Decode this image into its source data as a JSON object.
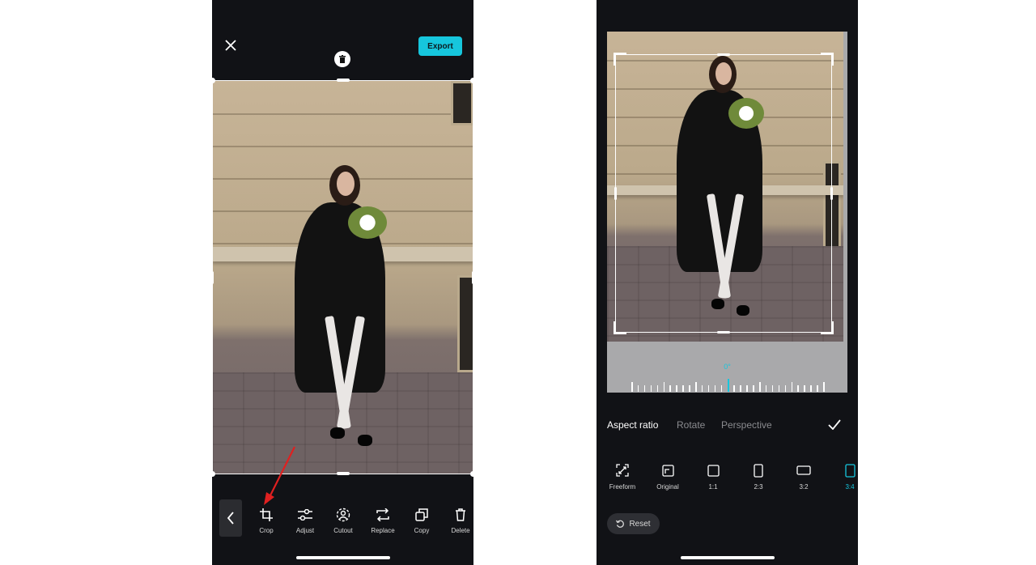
{
  "left_screen": {
    "header": {
      "export_label": "Export",
      "close_icon": "close-icon",
      "delete_handle_icon": "trash-icon"
    },
    "toolbar": {
      "back_icon": "chevron-left-icon",
      "items": [
        {
          "label": "Crop",
          "icon": "crop-icon"
        },
        {
          "label": "Adjust",
          "icon": "sliders-icon"
        },
        {
          "label": "Cutout",
          "icon": "cutout-icon"
        },
        {
          "label": "Replace",
          "icon": "replace-icon"
        },
        {
          "label": "Copy",
          "icon": "copy-icon"
        },
        {
          "label": "Delete",
          "icon": "trash-icon"
        }
      ],
      "annotation_color": "#e02020"
    }
  },
  "right_screen": {
    "rotation_value": "0°",
    "tabs": [
      {
        "label": "Aspect ratio",
        "active": true
      },
      {
        "label": "Rotate",
        "active": false
      },
      {
        "label": "Perspective",
        "active": false
      }
    ],
    "confirm_icon": "check-icon",
    "ratios": [
      {
        "label": "Freeform",
        "icon": "freeform-icon",
        "active": false
      },
      {
        "label": "Original",
        "icon": "original-icon",
        "active": false
      },
      {
        "label": "1:1",
        "icon": "square-icon",
        "active": false
      },
      {
        "label": "2:3",
        "icon": "portrait-icon",
        "active": false
      },
      {
        "label": "3:2",
        "icon": "landscape-icon",
        "active": false
      },
      {
        "label": "3:4",
        "icon": "portrait-icon",
        "active": true
      }
    ],
    "reset_label": "Reset",
    "accent_color": "#16c6dd"
  }
}
